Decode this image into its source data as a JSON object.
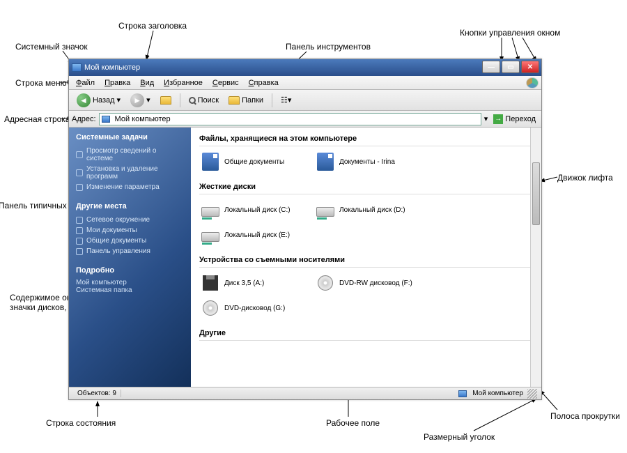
{
  "annotations": {
    "system_icon": "Системный значок",
    "titlebar": "Строка заголовка",
    "toolbar": "Панель инструментов",
    "window_controls": "Кнопки управления окном",
    "menubar": "Строка меню",
    "addressbar": "Адресная строка",
    "tasks_panel": "Панель типичных задач",
    "content_icons": "Содержимое окна:\nзначки дисков, папок",
    "statusbar": "Строка состояния",
    "work_area": "Рабочее поле",
    "resize_corner": "Размерный уголок",
    "scrollbar": "Полоса прокрутки",
    "scroll_thumb": "Движок лифта"
  },
  "window": {
    "title": "Мой компьютер"
  },
  "menu": [
    "Файл",
    "Правка",
    "Вид",
    "Избранное",
    "Сервис",
    "Справка"
  ],
  "toolbar": {
    "back": "Назад",
    "search": "Поиск",
    "folders": "Папки"
  },
  "address": {
    "label": "Адрес:",
    "value": "Мой компьютер",
    "go": "Переход"
  },
  "sidebar": {
    "groups": [
      {
        "title": "Системные задачи",
        "items": [
          "Просмотр сведений о системе",
          "Установка и удаление программ",
          "Изменение параметра"
        ]
      },
      {
        "title": "Другие места",
        "items": [
          "Сетевое окружение",
          "Мои документы",
          "Общие документы",
          "Панель управления"
        ]
      },
      {
        "title": "Подробно",
        "items": [
          "Мой компьютер",
          "Системная папка"
        ]
      }
    ]
  },
  "content": {
    "sections": [
      {
        "title": "Файлы, хранящиеся на этом компьютере",
        "items": [
          {
            "icon": "doc",
            "label": "Общие документы"
          },
          {
            "icon": "doc",
            "label": "Документы - Irina"
          }
        ]
      },
      {
        "title": "Жесткие диски",
        "items": [
          {
            "icon": "drive",
            "label": "Локальный диск (C:)"
          },
          {
            "icon": "drive",
            "label": "Локальный диск (D:)"
          },
          {
            "icon": "drive",
            "label": "Локальный диск (E:)"
          }
        ]
      },
      {
        "title": "Устройства со съемными носителями",
        "items": [
          {
            "icon": "floppy",
            "label": "Диск 3,5 (A:)"
          },
          {
            "icon": "cd",
            "label": "DVD-RW дисковод (F:)"
          },
          {
            "icon": "cd",
            "label": "DVD-дисковод (G:)"
          }
        ]
      },
      {
        "title": "Другие",
        "items": []
      }
    ]
  },
  "status": {
    "objects": "Объектов: 9",
    "location": "Мой компьютер"
  }
}
